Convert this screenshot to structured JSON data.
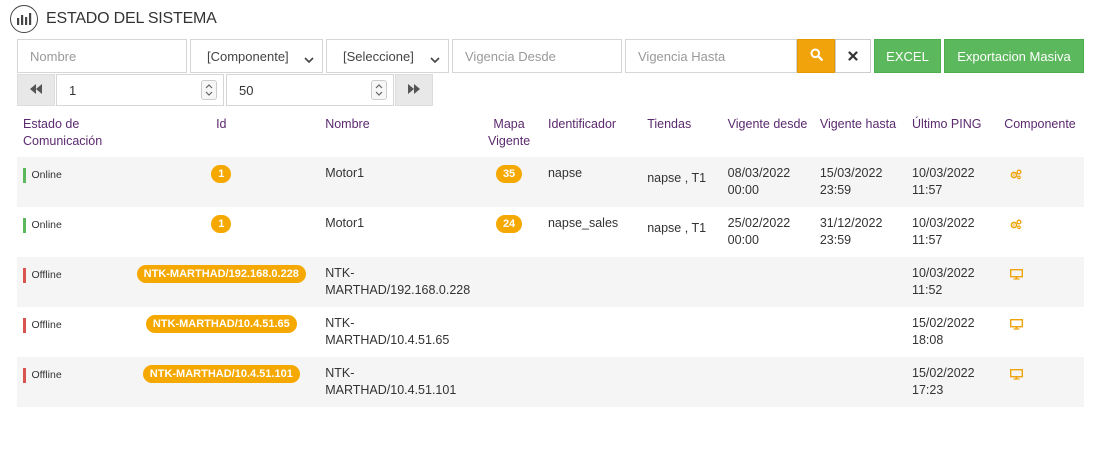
{
  "header": {
    "title": "ESTADO DEL SISTEMA",
    "icon": "bar-chart-icon"
  },
  "filters": {
    "nombre_placeholder": "Nombre",
    "componente_value": "[Componente]",
    "seleccione_value": "[Seleccione]",
    "vigencia_desde_placeholder": "Vigencia Desde",
    "vigencia_hasta_placeholder": "Vigencia Hasta",
    "excel_label": "EXCEL",
    "exportacion_label": "Exportacion Masiva"
  },
  "pager": {
    "page": "1",
    "page_size": "50"
  },
  "colors": {
    "accent": "#f5a800",
    "green": "#5cb85c",
    "online": "#5cb85c",
    "offline": "#d9534f",
    "header_text": "#5b2a6e"
  },
  "table": {
    "headers": {
      "estado": "Estado de Comunicación",
      "id": "Id",
      "nombre": "Nombre",
      "mapa": "Mapa Vigente",
      "identificador": "Identificador",
      "tiendas": "Tiendas",
      "vigente_desde": "Vigente desde",
      "vigente_hasta": "Vigente hasta",
      "ultimo_ping": "Último PING",
      "componente": "Componente"
    },
    "rows": [
      {
        "estado": "Online",
        "id": "1",
        "nombre": "Motor1",
        "mapa": "35",
        "identificador": "napse",
        "tiendas": "napse , T1",
        "desde": "08/03/2022 00:00",
        "hasta": "15/03/2022 23:59",
        "ping": "10/03/2022 11:57",
        "componente_icon": "gears-icon"
      },
      {
        "estado": "Online",
        "id": "1",
        "nombre": "Motor1",
        "mapa": "24",
        "identificador": "napse_sales",
        "tiendas": "napse , T1",
        "desde": "25/02/2022 00:00",
        "hasta": "31/12/2022 23:59",
        "ping": "10/03/2022 11:57",
        "componente_icon": "gears-icon"
      },
      {
        "estado": "Offline",
        "id": "NTK-MARTHAD/192.168.0.228",
        "nombre": "NTK-MARTHAD/192.168.0.228",
        "mapa": "",
        "identificador": "",
        "tiendas": "",
        "desde": "",
        "hasta": "",
        "ping": "10/03/2022 11:52",
        "componente_icon": "monitor-icon"
      },
      {
        "estado": "Offline",
        "id": "NTK-MARTHAD/10.4.51.65",
        "nombre": "NTK-MARTHAD/10.4.51.65",
        "mapa": "",
        "identificador": "",
        "tiendas": "",
        "desde": "",
        "hasta": "",
        "ping": "15/02/2022 18:08",
        "componente_icon": "monitor-icon"
      },
      {
        "estado": "Offline",
        "id": "NTK-MARTHAD/10.4.51.101",
        "nombre": "NTK-MARTHAD/10.4.51.101",
        "mapa": "",
        "identificador": "",
        "tiendas": "",
        "desde": "",
        "hasta": "",
        "ping": "15/02/2022 17:23",
        "componente_icon": "monitor-icon"
      }
    ]
  }
}
